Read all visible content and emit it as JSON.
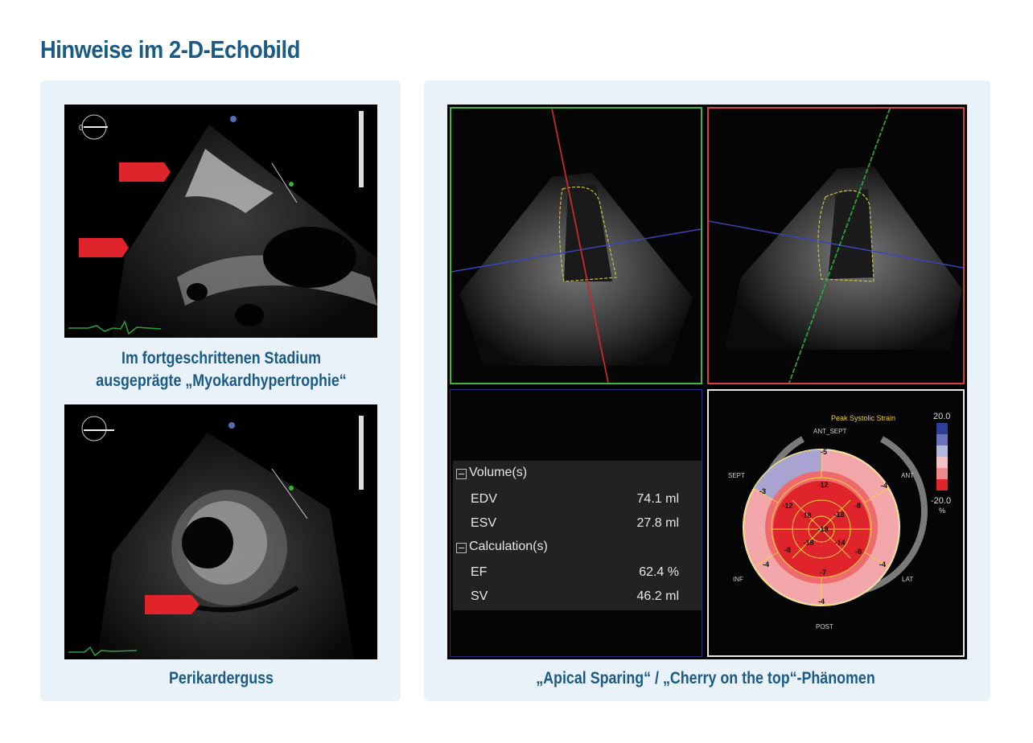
{
  "title": "Hinweise im 2-D-Echobild",
  "left_panel": {
    "caption_top_line1": "Im fortgeschrittenen Stadium",
    "caption_top_line2": "ausgeprägte „Myokardhypertrophie“",
    "caption_bottom": "Perikarderguss",
    "echo_probe_marker": "0"
  },
  "right_panel": {
    "caption": "„Apical Sparing“ / „Cherry on the top“-Phänomen",
    "measurements": {
      "volume_header": "Volume(s)",
      "calc_header": "Calculation(s)",
      "rows": [
        {
          "label": "EDV",
          "value": "74.1 ml"
        },
        {
          "label": "ESV",
          "value": "27.8 ml"
        },
        {
          "label": "EF",
          "value": "62.4 %"
        },
        {
          "label": "SV",
          "value": "46.2 ml"
        }
      ]
    },
    "bullseye": {
      "title": "Peak Systolic Strain",
      "scale_max": "20.0",
      "scale_min": "-20.0",
      "scale_unit": "%",
      "labels": {
        "ant_sept": "ANT_SEPT",
        "ant": "ANT",
        "lat": "LAT",
        "post": "POST",
        "inf": "INF",
        "sept": "SEPT"
      },
      "segments": {
        "outer": [
          "-5",
          "-4",
          "-4",
          "-4",
          "-4",
          "-3"
        ],
        "mid": [
          "-12",
          "-8",
          "-8",
          "-7",
          "-8",
          "-12"
        ],
        "apical": [
          "-18",
          "-14",
          "-18",
          "-18"
        ],
        "apex": "-19"
      },
      "colors": {
        "strong": "#e0242c",
        "medium": "#ee6a6c",
        "light": "#f4a7aa",
        "blue": "#9aa2d8"
      }
    },
    "frame_colors": {
      "top_left": "#3fb53f",
      "top_right": "#d0414a",
      "bottom_left": "#2d2f86",
      "bottom_right": "#e8e8e8"
    }
  }
}
